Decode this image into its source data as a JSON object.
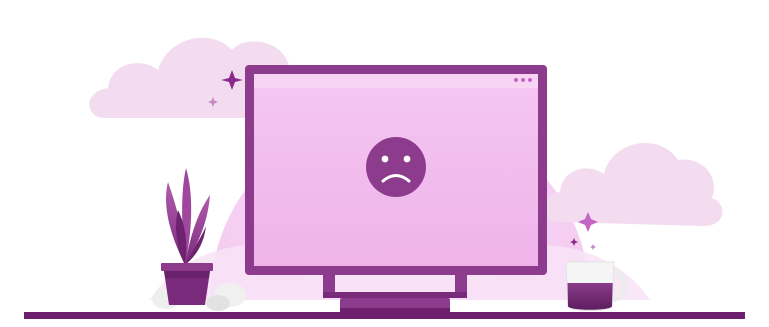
{
  "illustration": {
    "theme_colors": {
      "deep_purple": "#7a2a7a",
      "frame_purple": "#8d3b8c",
      "screen_pink": "#f1b8ee",
      "halo_pink": "#f6d4f3",
      "cloud_pink": "#f3dcef",
      "sparkle_purple": "#8b2a8e",
      "floor_purple": "#6d1f6e"
    },
    "elements": {
      "monitor": "computer-monitor",
      "screen_face": "sad-face-icon",
      "window_controls": "window-dots-icon",
      "plant": "potted-plant",
      "mug": "coffee-mug",
      "clouds": "cloud-icon",
      "sparkles": "sparkle-icon"
    }
  }
}
